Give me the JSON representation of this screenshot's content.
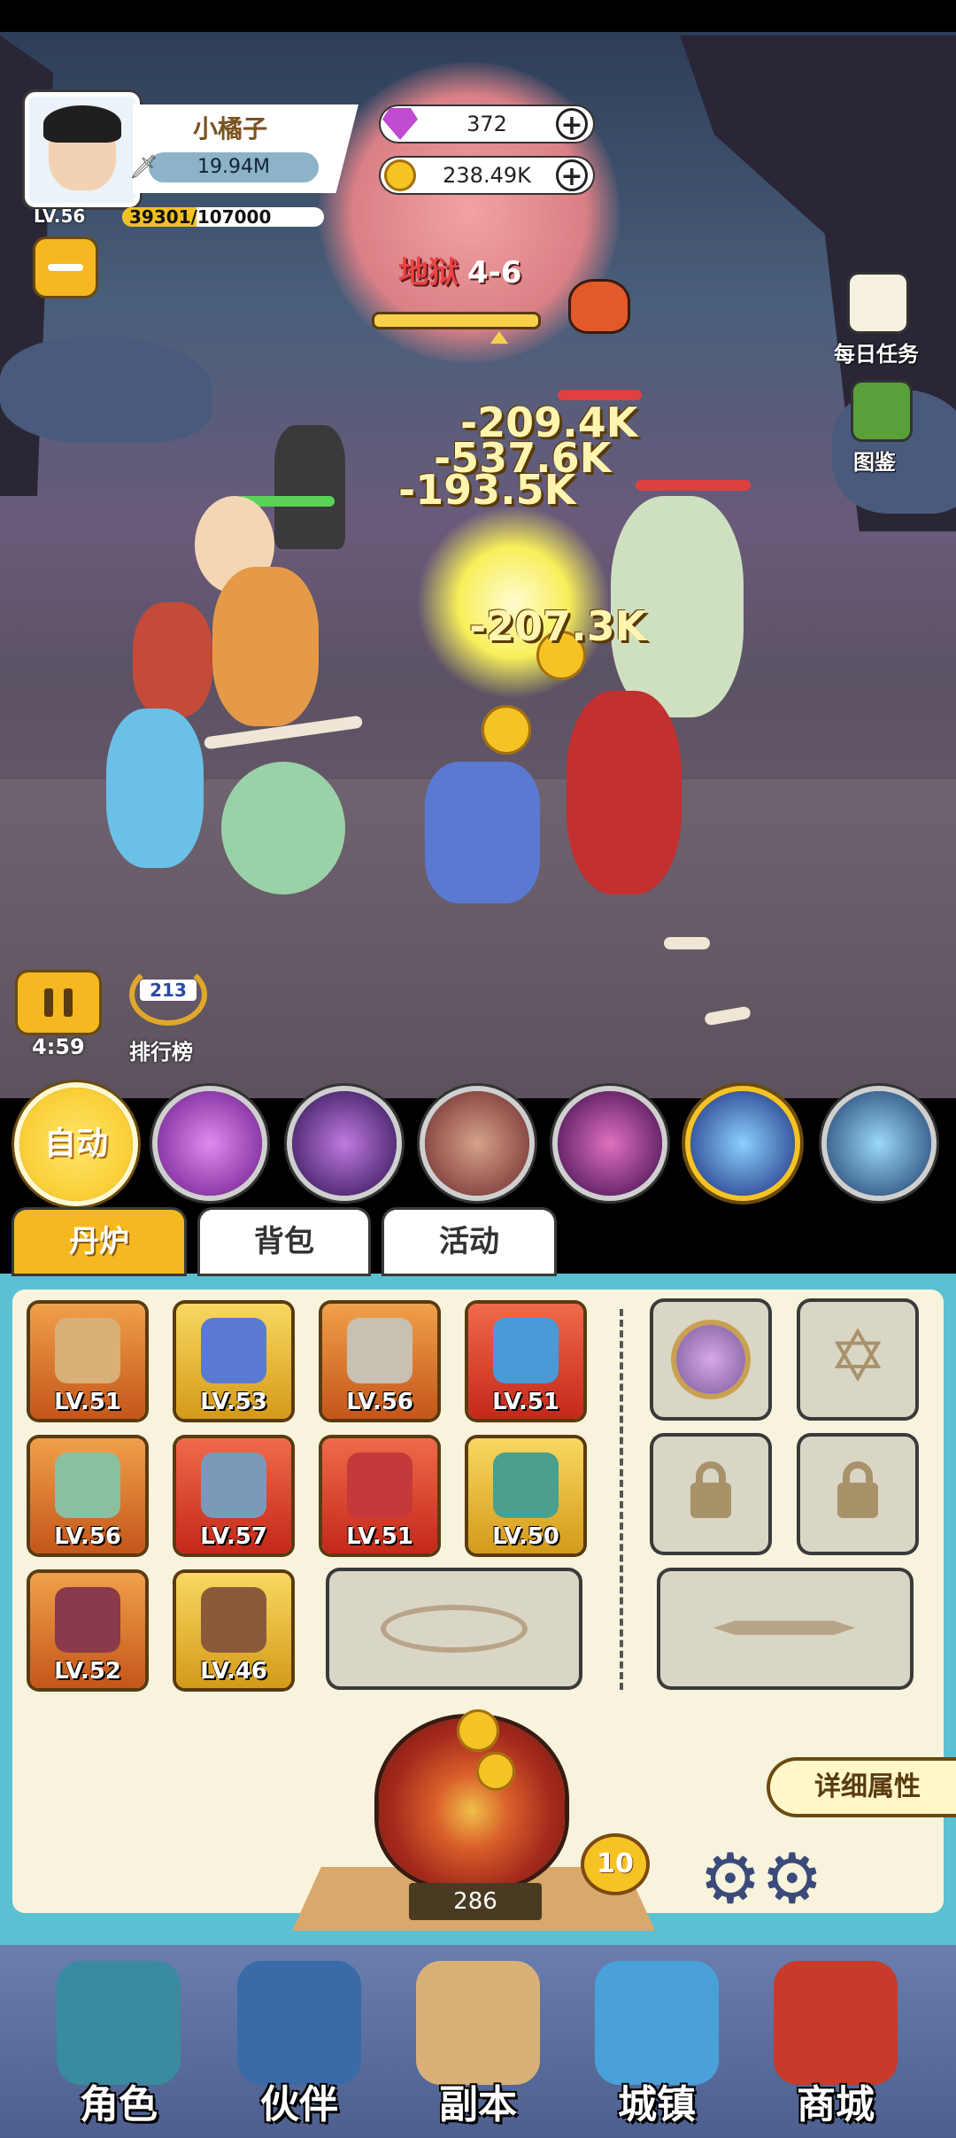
{
  "player": {
    "name": "小橘子",
    "power": "19.94M",
    "level": "LV.56",
    "xp_text": "39301/107000",
    "xp_fraction": 0.367
  },
  "resources": {
    "gems": "372",
    "gold": "238.49K"
  },
  "stage": {
    "prefix": "地狱",
    "number": "4-6",
    "progress_fraction": 0.78
  },
  "side_menu": {
    "daily_tasks": "每日任务",
    "codex": "图鉴"
  },
  "damage_numbers": [
    "-209.4K",
    "-537.6K",
    "-193.5K",
    "-207.3K"
  ],
  "battle": {
    "timer": "4:59",
    "ranking": "排行榜",
    "ranking_icon_text": "213"
  },
  "skills": {
    "auto_label": "自动",
    "icons": [
      "purple-lightning-skill-icon",
      "purple-vortex-skill-icon",
      "beast-skill-icon",
      "spiral-skill-icon",
      "blue-comet-skill-icon",
      "ice-wall-skill-icon"
    ]
  },
  "tabs": [
    "丹炉",
    "背包",
    "活动"
  ],
  "equipment": [
    {
      "level": "LV.51",
      "icon": "spear-icon",
      "frame": "orange"
    },
    {
      "level": "LV.53",
      "icon": "helmet-icon",
      "frame": "yellow"
    },
    {
      "level": "LV.56",
      "icon": "armor-icon",
      "frame": "orange"
    },
    {
      "level": "LV.51",
      "icon": "orb-icon",
      "frame": "red"
    },
    {
      "level": "LV.56",
      "icon": "fan-icon",
      "frame": "orange"
    },
    {
      "level": "LV.57",
      "icon": "bagua-icon",
      "frame": "red"
    },
    {
      "level": "LV.51",
      "icon": "necklace-icon",
      "frame": "red"
    },
    {
      "level": "LV.50",
      "icon": "jade-pendant-icon",
      "frame": "yellow"
    },
    {
      "level": "LV.52",
      "icon": "belt-icon",
      "frame": "orange"
    },
    {
      "level": "LV.46",
      "icon": "boots-icon",
      "frame": "yellow"
    }
  ],
  "panel": {
    "detail_button": "详细属性",
    "furnace_count": "286",
    "furnace_level": "10"
  },
  "nav": [
    "角色",
    "伙伴",
    "副本",
    "城镇",
    "商城"
  ],
  "colors": {
    "accent_yellow": "#f6b820",
    "panel_bg": "#f8f3dc",
    "panel_border": "#5ac0d2",
    "nav_bg": "#5a6fa0"
  }
}
